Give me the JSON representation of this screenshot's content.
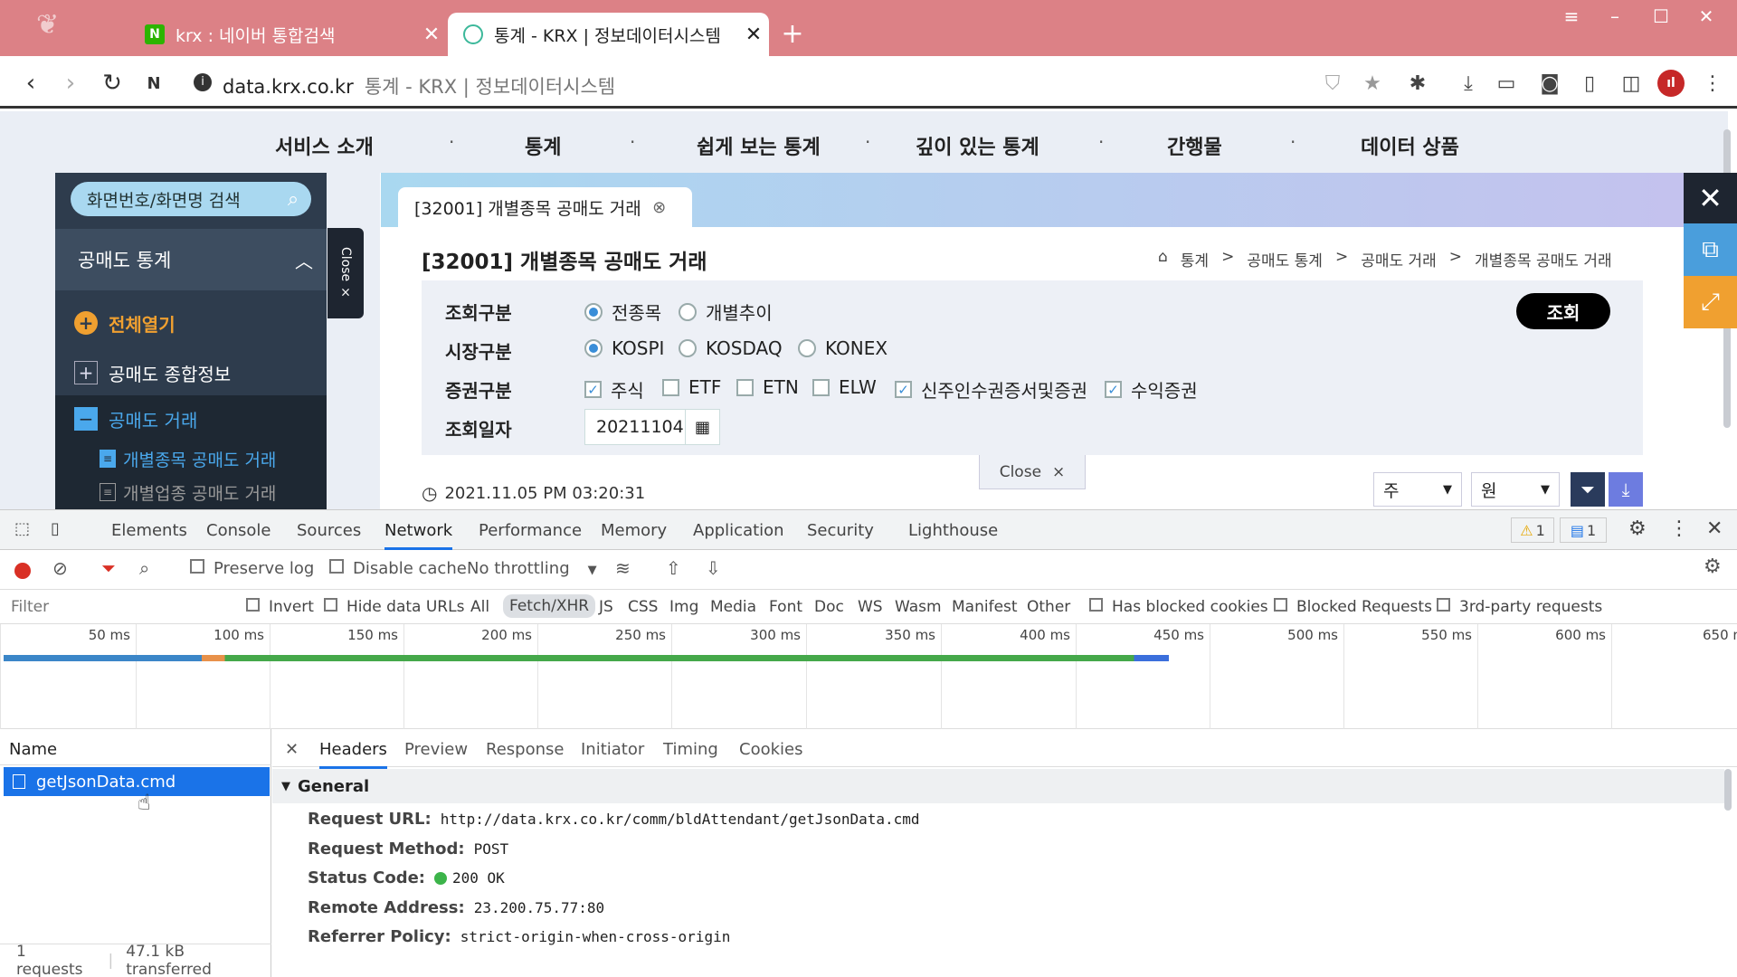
{
  "browser": {
    "tabs": [
      {
        "title": "krx : 네이버 통합검색",
        "favicon": "naver-icon",
        "close": "✕"
      },
      {
        "title": "통계 - KRX | 정보데이터시스템",
        "favicon": "loading-icon",
        "close": "✕"
      }
    ],
    "new_tab": "+",
    "url_host": "data.krx.co.kr",
    "url_title": "통계 - KRX | 정보데이터시스템"
  },
  "site": {
    "menu": [
      "서비스 소개",
      "통계",
      "쉽게 보는 통계",
      "깊이 있는 통계",
      "간행물",
      "데이터 상품"
    ],
    "menu_sep": "·",
    "search_label": "화면번호/화면명 검색",
    "panel_title": "공매도 통계",
    "expand_all": "전체열기",
    "tree": [
      "공매도 종합정보",
      "공매도 거래",
      "개별종목 공매도 거래",
      "개별업종 공매도 거래"
    ],
    "close_vertical": "Close ×",
    "content_tab": "[32001] 개별종목 공매도 거래",
    "page_title": "[32001] 개별종목 공매도 거래",
    "breadcrumb": [
      "통계",
      "공매도 통계",
      "공매도 거래",
      "개별종목 공매도 거래"
    ],
    "breadcrumb_sep": ">",
    "form": {
      "label_query_type": "조회구분",
      "query_types": [
        "전종목",
        "개별추이"
      ],
      "label_market": "시장구분",
      "markets": [
        "KOSPI",
        "KOSDAQ",
        "KONEX"
      ],
      "label_security": "증권구분",
      "securities": [
        {
          "label": "주식",
          "checked": true
        },
        {
          "label": "ETF",
          "checked": false
        },
        {
          "label": "ETN",
          "checked": false
        },
        {
          "label": "ELW",
          "checked": false
        },
        {
          "label": "신주인수권증서및증권",
          "checked": true
        },
        {
          "label": "수익증권",
          "checked": true
        }
      ],
      "label_date": "조회일자",
      "date": "20211104",
      "search_button": "조회"
    },
    "close_button": "Close",
    "timestamp": "2021.11.05 PM 03:20:31",
    "unit_share": "주",
    "unit_currency": "원",
    "colors": {
      "accent_blue": "#3a8ed8",
      "orange": "#f0a030"
    }
  },
  "devtools": {
    "tabs": [
      "Elements",
      "Console",
      "Sources",
      "Network",
      "Performance",
      "Memory",
      "Application",
      "Security",
      "Lighthouse"
    ],
    "warn_count": "1",
    "msg_count": "1",
    "preserve_log": "Preserve log",
    "disable_cache": "Disable cache",
    "throttling": "No throttling",
    "filter_placeholder": "Filter",
    "invert": "Invert",
    "hide_data_urls": "Hide data URLs",
    "type_filters": [
      "All",
      "Fetch/XHR",
      "JS",
      "CSS",
      "Img",
      "Media",
      "Font",
      "Doc",
      "WS",
      "Wasm",
      "Manifest",
      "Other"
    ],
    "has_blocked_cookies": "Has blocked cookies",
    "blocked_requests": "Blocked Requests",
    "third_party": "3rd-party requests",
    "ticks": [
      "50 ms",
      "100 ms",
      "150 ms",
      "200 ms",
      "250 ms",
      "300 ms",
      "350 ms",
      "400 ms",
      "450 ms",
      "500 ms",
      "550 ms",
      "600 ms",
      "650 m"
    ],
    "name_header": "Name",
    "request_name": "getJsonData.cmd",
    "footer_requests": "1 requests",
    "footer_transferred": "47.1 kB transferred",
    "detail_tabs": [
      "Headers",
      "Preview",
      "Response",
      "Initiator",
      "Timing",
      "Cookies"
    ],
    "general": "General",
    "headers": [
      {
        "k": "Request URL:",
        "v": "http://data.krx.co.kr/comm/bldAttendant/getJsonData.cmd"
      },
      {
        "k": "Request Method:",
        "v": "POST"
      },
      {
        "k": "Status Code:",
        "v": "200 OK"
      },
      {
        "k": "Remote Address:",
        "v": "23.200.75.77:80"
      },
      {
        "k": "Referrer Policy:",
        "v": "strict-origin-when-cross-origin"
      }
    ]
  }
}
